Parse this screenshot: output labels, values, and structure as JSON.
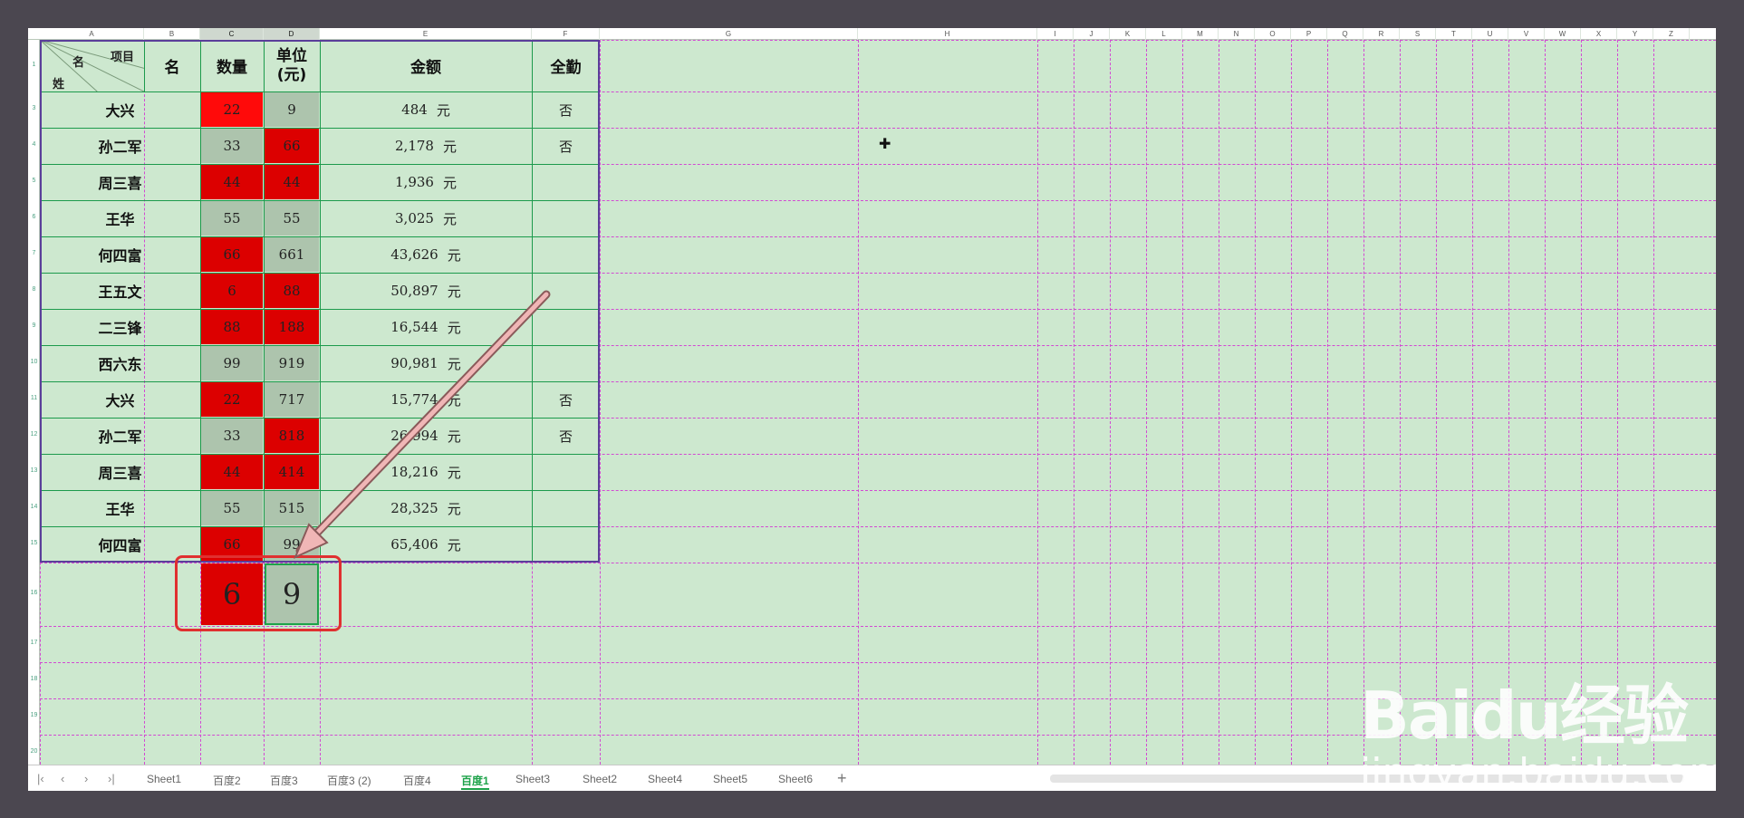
{
  "columns": [
    {
      "letter": "A",
      "w": 115
    },
    {
      "letter": "B",
      "w": 62
    },
    {
      "letter": "C",
      "w": 70,
      "selected": true
    },
    {
      "letter": "D",
      "w": 62,
      "selected": true
    },
    {
      "letter": "E",
      "w": 234
    },
    {
      "letter": "F",
      "w": 75
    },
    {
      "letter": "G",
      "w": 285
    },
    {
      "letter": "H",
      "w": 198
    },
    {
      "letter": "I",
      "w": 40
    },
    {
      "letter": "J",
      "w": 40
    },
    {
      "letter": "K",
      "w": 40
    },
    {
      "letter": "L",
      "w": 40
    },
    {
      "letter": "M",
      "w": 40
    },
    {
      "letter": "N",
      "w": 40
    },
    {
      "letter": "O",
      "w": 40
    },
    {
      "letter": "P",
      "w": 40
    },
    {
      "letter": "Q",
      "w": 40
    },
    {
      "letter": "R",
      "w": 40
    },
    {
      "letter": "S",
      "w": 40
    },
    {
      "letter": "T",
      "w": 40
    },
    {
      "letter": "U",
      "w": 40
    },
    {
      "letter": "V",
      "w": 40
    },
    {
      "letter": "W",
      "w": 40
    },
    {
      "letter": "X",
      "w": 40
    },
    {
      "letter": "Y",
      "w": 40
    },
    {
      "letter": "Z",
      "w": 40
    }
  ],
  "row_numbers": [
    "1",
    "3",
    "4",
    "5",
    "6",
    "7",
    "8",
    "9",
    "10",
    "11",
    "12",
    "13",
    "14",
    "15",
    "16",
    "17",
    "18",
    "19",
    "20"
  ],
  "header": {
    "corner_top": "项目",
    "corner_mid": "名",
    "corner_bottom": "姓",
    "col_b": "名",
    "col_c": "数量",
    "col_d_line1": "单位",
    "col_d_line2": "(元)",
    "col_e": "金额",
    "col_f": "全勤"
  },
  "rows": [
    {
      "name": "大兴",
      "qty": "22",
      "unit": "9",
      "amount": "484",
      "currency": "元",
      "attendance": "否",
      "qty_color": "red-bright",
      "unit_color": "gray"
    },
    {
      "name": "孙二军",
      "qty": "33",
      "unit": "66",
      "amount": "2,178",
      "currency": "元",
      "attendance": "否",
      "qty_color": "gray",
      "unit_color": "red"
    },
    {
      "name": "周三喜",
      "qty": "44",
      "unit": "44",
      "amount": "1,936",
      "currency": "元",
      "attendance": "",
      "qty_color": "red",
      "unit_color": "red"
    },
    {
      "name": "王华",
      "qty": "55",
      "unit": "55",
      "amount": "3,025",
      "currency": "元",
      "attendance": "",
      "qty_color": "gray",
      "unit_color": "gray"
    },
    {
      "name": "何四富",
      "qty": "66",
      "unit": "661",
      "amount": "43,626",
      "currency": "元",
      "attendance": "",
      "qty_color": "red",
      "unit_color": "gray"
    },
    {
      "name": "王五文",
      "qty": "6",
      "unit": "88",
      "amount": "50,897",
      "currency": "元",
      "attendance": "",
      "qty_color": "red",
      "unit_color": "red"
    },
    {
      "name": "二三锋",
      "qty": "88",
      "unit": "188",
      "amount": "16,544",
      "currency": "元",
      "attendance": "",
      "qty_color": "red",
      "unit_color": "red"
    },
    {
      "name": "西六东",
      "qty": "99",
      "unit": "919",
      "amount": "90,981",
      "currency": "元",
      "attendance": "",
      "qty_color": "gray",
      "unit_color": "gray"
    },
    {
      "name": "大兴",
      "qty": "22",
      "unit": "717",
      "amount": "15,774",
      "currency": "元",
      "attendance": "否",
      "qty_color": "red",
      "unit_color": "gray"
    },
    {
      "name": "孙二军",
      "qty": "33",
      "unit": "818",
      "amount": "26,994",
      "currency": "元",
      "attendance": "否",
      "qty_color": "gray",
      "unit_color": "red"
    },
    {
      "name": "周三喜",
      "qty": "44",
      "unit": "414",
      "amount": "18,216",
      "currency": "元",
      "attendance": "",
      "qty_color": "red",
      "unit_color": "red"
    },
    {
      "name": "王华",
      "qty": "55",
      "unit": "515",
      "amount": "28,325",
      "currency": "元",
      "attendance": "",
      "qty_color": "gray",
      "unit_color": "gray"
    },
    {
      "name": "何四富",
      "qty": "66",
      "unit": "99",
      "amount": "65,406",
      "currency": "元",
      "attendance": "",
      "qty_color": "red",
      "unit_color": "gray"
    }
  ],
  "new_row": {
    "qty": "6",
    "unit": "9",
    "qty_color": "red",
    "unit_color": "gray"
  },
  "tabs": {
    "nav": [
      "|‹",
      "‹",
      "›",
      "›|"
    ],
    "sheets": [
      {
        "label": "Sheet1"
      },
      {
        "label": "百度2"
      },
      {
        "label": "百度3"
      },
      {
        "label": "百度3 (2)"
      },
      {
        "label": "百度4"
      },
      {
        "label": "百度1",
        "active": true
      },
      {
        "label": "Sheet3"
      },
      {
        "label": "Sheet2"
      },
      {
        "label": "Sheet4"
      },
      {
        "label": "Sheet5"
      },
      {
        "label": "Sheet6"
      }
    ],
    "add": "+"
  },
  "watermark": {
    "logo": "Baidu经验",
    "url": "jingyan.baidu.com"
  },
  "colors": {
    "red": "#dc0000",
    "red_bright": "#ff0a0a",
    "gray": "#adc4ad",
    "sheet_bg": "#cde8cf",
    "table_border": "#5a3e9a",
    "highlight": "#e03030",
    "arrow": "#f0b6b6"
  }
}
